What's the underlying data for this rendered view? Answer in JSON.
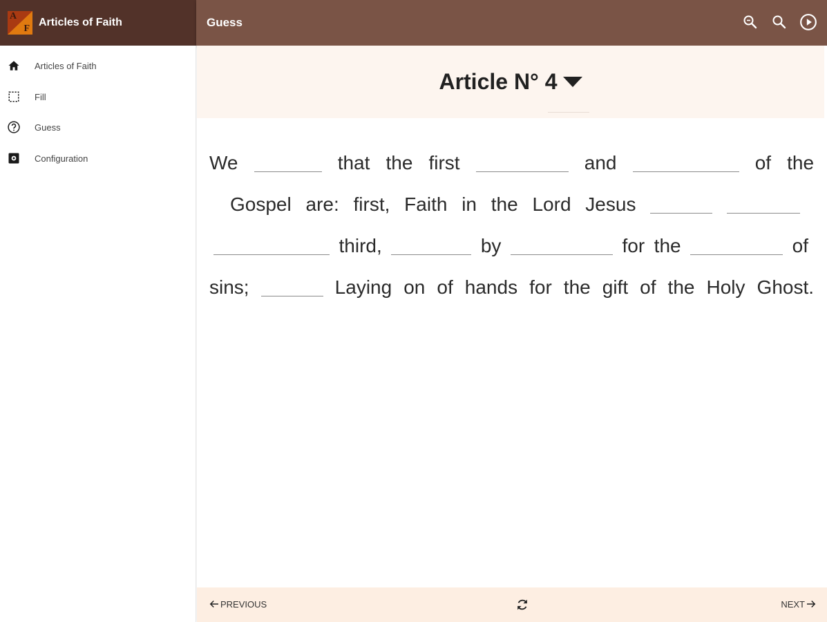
{
  "app": {
    "title": "Articles of Faith",
    "logo_letters": [
      "A",
      "F"
    ],
    "screen_title": "Guess",
    "colors": {
      "sidebar_header": "#523229",
      "appbar": "#7a5446",
      "article_header_bg": "#fdf5ef",
      "bottom_bar_bg": "#fdeee2"
    }
  },
  "toolbar": {
    "actions": [
      {
        "icon": "zoom-out-icon"
      },
      {
        "icon": "zoom-in-icon"
      },
      {
        "icon": "play-circle-icon"
      }
    ]
  },
  "sidebar": {
    "items": [
      {
        "label": "Articles of Faith",
        "icon": "home-icon"
      },
      {
        "label": "Fill",
        "icon": "dashed-square-icon"
      },
      {
        "label": "Guess",
        "icon": "help-circle-icon"
      },
      {
        "label": "Configuration",
        "icon": "settings-box-icon"
      }
    ]
  },
  "article": {
    "title": "Article N° 4",
    "lines": [
      [
        "We",
        "that the first",
        "and",
        "of the"
      ],
      [
        "Gospel are: first, Faith in the Lord Jesus",
        "",
        ""
      ],
      [
        "",
        "third,",
        "by",
        "for the",
        "of"
      ],
      [
        "sins;",
        "Laying on of hands for the gift of the Holy Ghost."
      ]
    ],
    "text": {
      "w1": "We",
      "w2": "that the first",
      "w3": "and",
      "w4": "of the",
      "w5": "Gospel are: first, Faith in the Lord Jesus",
      "w6": "third,",
      "w7": "by",
      "w8": "for the",
      "w9": "of",
      "w10": "sins;",
      "w11": "Laying on of hands for the gift of the Holy Ghost."
    }
  },
  "navigation": {
    "previous_label": "PREVIOUS",
    "next_label": "NEXT",
    "refresh_icon": "refresh-icon"
  }
}
